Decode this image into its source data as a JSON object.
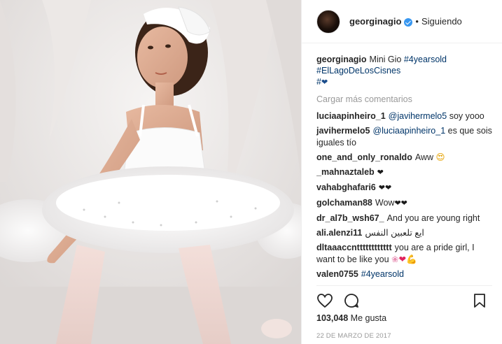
{
  "header": {
    "username": "georginagio",
    "separator": "•",
    "follow_status": "Siguiendo"
  },
  "caption": {
    "username": "georginagio",
    "text": "Mini Gio",
    "tag1": "#4yearsold",
    "tag2": "#ElLagoDeLosCisnes",
    "tag3": "#"
  },
  "load_more": "Cargar más comentarios",
  "comments": [
    {
      "user": "luciaapinheiro_1",
      "mention": "@javihermelo5",
      "text": "soy yooo"
    },
    {
      "user": "javihermelo5",
      "mention": "@luciaapinheiro_1",
      "text": "es que sois iguales tío"
    },
    {
      "user": "one_and_only_ronaldo",
      "text": "Aww"
    },
    {
      "user": "_mahnaztaleb",
      "text": ""
    },
    {
      "user": "vahabghafari6",
      "text": ""
    },
    {
      "user": "golchaman88",
      "text": "Wow"
    },
    {
      "user": "dr_al7b_wsh67_",
      "text": "And you are young right"
    },
    {
      "user": "ali.alenzi11",
      "text": "ايع تلعبين النفس"
    },
    {
      "user": "dltaaaccntttttttttttt",
      "text": "you are a pride girl, I want to be like you"
    },
    {
      "user": "valen0755",
      "tag": "#4yearsold"
    }
  ],
  "likes": {
    "count": "103,048",
    "label": "Me gusta"
  },
  "date": "22 DE MARZO DE 2017",
  "icons": {
    "like": "heart-icon",
    "comment": "comment-icon",
    "save": "bookmark-icon",
    "verified": "verified-badge-icon"
  },
  "colors": {
    "link": "#003569",
    "verified": "#3897f0",
    "muted": "#999999"
  }
}
